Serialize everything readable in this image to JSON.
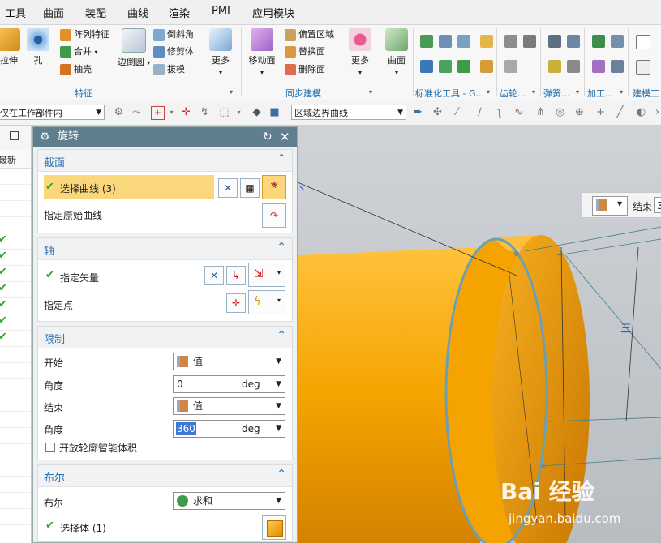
{
  "menu": [
    "工具",
    "曲面",
    "装配",
    "曲线",
    "渲染",
    "PMI",
    "应用模块"
  ],
  "ribbon": {
    "feature_group": {
      "big_buttons": [
        {
          "label": "拉伸",
          "icon": "extrude-icon"
        },
        {
          "label": "孔",
          "icon": "hole-icon"
        },
        {
          "label": "边倒圆",
          "icon": "edge-blend-icon"
        },
        {
          "label": "更多",
          "icon": "more-icon"
        }
      ],
      "small_buttons": [
        {
          "label": "阵列特征",
          "icon": "pattern-feature-icon"
        },
        {
          "label": "合并",
          "icon": "unite-icon"
        },
        {
          "label": "抽壳",
          "icon": "shell-icon"
        },
        {
          "label": "倒斜角",
          "icon": "chamfer-icon"
        },
        {
          "label": "修剪体",
          "icon": "trim-body-icon"
        },
        {
          "label": "拔模",
          "icon": "draft-icon"
        }
      ],
      "label": "特征"
    },
    "sync_group": {
      "big_buttons": [
        {
          "label": "移动面",
          "icon": "move-face-icon"
        },
        {
          "label": "更多",
          "icon": "more-icon"
        }
      ],
      "small_buttons": [
        {
          "label": "偏置区域",
          "icon": "offset-region-icon"
        },
        {
          "label": "替换面",
          "icon": "replace-face-icon"
        },
        {
          "label": "删除面",
          "icon": "delete-face-icon"
        }
      ],
      "label": "同步建模"
    },
    "surface_button": {
      "label": "曲面",
      "icon": "surface-icon"
    },
    "other_groups": [
      "标准化工具 - G...",
      "齿轮...",
      "弹簧...",
      "加工...",
      "建模工"
    ]
  },
  "toolbar": {
    "scope_combo": "仅在工作部件内",
    "curve_rule_combo": "区域边界曲线"
  },
  "nav": {
    "header": "最新",
    "check_count": 7
  },
  "dialog": {
    "title": "旋转",
    "section_section": {
      "title": "截面",
      "select_curve": "选择曲线 (3)",
      "specify_origin_curve": "指定原始曲线"
    },
    "section_axis": {
      "title": "轴",
      "specify_vector": "指定矢量",
      "specify_point": "指定点"
    },
    "section_limits": {
      "title": "限制",
      "start_label": "开始",
      "start_value": "值",
      "angle_label": "角度",
      "start_angle": "0",
      "unit": "deg",
      "end_label": "结束",
      "end_value": "值",
      "end_angle": "360",
      "open_profile": "开放轮廓智能体积"
    },
    "section_boolean": {
      "title": "布尔",
      "boolean_label": "布尔",
      "boolean_value": "求和",
      "select_body": "选择体 (1)"
    }
  },
  "viewport": {
    "end_label": "结束",
    "end_value_partial": "3",
    "dim_label": "三",
    "watermark_logo": "Bai 经验",
    "watermark_url": "jingyan.baidu.com"
  },
  "colors": {
    "accent_blue": "#2a6fb5",
    "selection_yellow": "#f9d77a",
    "part_orange": "#f5a800",
    "dialog_title": "#5f7f8f"
  }
}
